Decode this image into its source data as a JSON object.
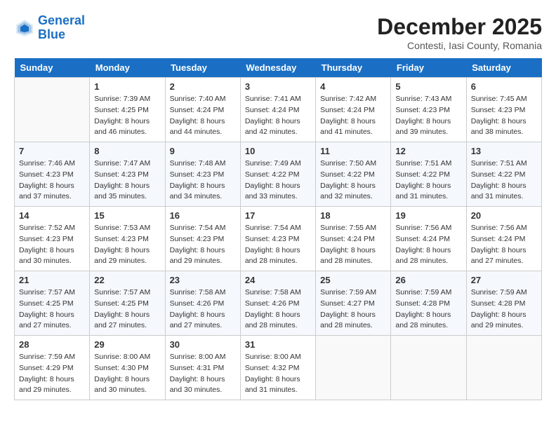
{
  "header": {
    "logo_line1": "General",
    "logo_line2": "Blue",
    "month": "December 2025",
    "location": "Contesti, Iasi County, Romania"
  },
  "weekdays": [
    "Sunday",
    "Monday",
    "Tuesday",
    "Wednesday",
    "Thursday",
    "Friday",
    "Saturday"
  ],
  "weeks": [
    [
      {
        "day": "",
        "info": ""
      },
      {
        "day": "1",
        "info": "Sunrise: 7:39 AM\nSunset: 4:25 PM\nDaylight: 8 hours\nand 46 minutes."
      },
      {
        "day": "2",
        "info": "Sunrise: 7:40 AM\nSunset: 4:24 PM\nDaylight: 8 hours\nand 44 minutes."
      },
      {
        "day": "3",
        "info": "Sunrise: 7:41 AM\nSunset: 4:24 PM\nDaylight: 8 hours\nand 42 minutes."
      },
      {
        "day": "4",
        "info": "Sunrise: 7:42 AM\nSunset: 4:24 PM\nDaylight: 8 hours\nand 41 minutes."
      },
      {
        "day": "5",
        "info": "Sunrise: 7:43 AM\nSunset: 4:23 PM\nDaylight: 8 hours\nand 39 minutes."
      },
      {
        "day": "6",
        "info": "Sunrise: 7:45 AM\nSunset: 4:23 PM\nDaylight: 8 hours\nand 38 minutes."
      }
    ],
    [
      {
        "day": "7",
        "info": "Sunrise: 7:46 AM\nSunset: 4:23 PM\nDaylight: 8 hours\nand 37 minutes."
      },
      {
        "day": "8",
        "info": "Sunrise: 7:47 AM\nSunset: 4:23 PM\nDaylight: 8 hours\nand 35 minutes."
      },
      {
        "day": "9",
        "info": "Sunrise: 7:48 AM\nSunset: 4:23 PM\nDaylight: 8 hours\nand 34 minutes."
      },
      {
        "day": "10",
        "info": "Sunrise: 7:49 AM\nSunset: 4:22 PM\nDaylight: 8 hours\nand 33 minutes."
      },
      {
        "day": "11",
        "info": "Sunrise: 7:50 AM\nSunset: 4:22 PM\nDaylight: 8 hours\nand 32 minutes."
      },
      {
        "day": "12",
        "info": "Sunrise: 7:51 AM\nSunset: 4:22 PM\nDaylight: 8 hours\nand 31 minutes."
      },
      {
        "day": "13",
        "info": "Sunrise: 7:51 AM\nSunset: 4:22 PM\nDaylight: 8 hours\nand 31 minutes."
      }
    ],
    [
      {
        "day": "14",
        "info": "Sunrise: 7:52 AM\nSunset: 4:23 PM\nDaylight: 8 hours\nand 30 minutes."
      },
      {
        "day": "15",
        "info": "Sunrise: 7:53 AM\nSunset: 4:23 PM\nDaylight: 8 hours\nand 29 minutes."
      },
      {
        "day": "16",
        "info": "Sunrise: 7:54 AM\nSunset: 4:23 PM\nDaylight: 8 hours\nand 29 minutes."
      },
      {
        "day": "17",
        "info": "Sunrise: 7:54 AM\nSunset: 4:23 PM\nDaylight: 8 hours\nand 28 minutes."
      },
      {
        "day": "18",
        "info": "Sunrise: 7:55 AM\nSunset: 4:24 PM\nDaylight: 8 hours\nand 28 minutes."
      },
      {
        "day": "19",
        "info": "Sunrise: 7:56 AM\nSunset: 4:24 PM\nDaylight: 8 hours\nand 28 minutes."
      },
      {
        "day": "20",
        "info": "Sunrise: 7:56 AM\nSunset: 4:24 PM\nDaylight: 8 hours\nand 27 minutes."
      }
    ],
    [
      {
        "day": "21",
        "info": "Sunrise: 7:57 AM\nSunset: 4:25 PM\nDaylight: 8 hours\nand 27 minutes."
      },
      {
        "day": "22",
        "info": "Sunrise: 7:57 AM\nSunset: 4:25 PM\nDaylight: 8 hours\nand 27 minutes."
      },
      {
        "day": "23",
        "info": "Sunrise: 7:58 AM\nSunset: 4:26 PM\nDaylight: 8 hours\nand 27 minutes."
      },
      {
        "day": "24",
        "info": "Sunrise: 7:58 AM\nSunset: 4:26 PM\nDaylight: 8 hours\nand 28 minutes."
      },
      {
        "day": "25",
        "info": "Sunrise: 7:59 AM\nSunset: 4:27 PM\nDaylight: 8 hours\nand 28 minutes."
      },
      {
        "day": "26",
        "info": "Sunrise: 7:59 AM\nSunset: 4:28 PM\nDaylight: 8 hours\nand 28 minutes."
      },
      {
        "day": "27",
        "info": "Sunrise: 7:59 AM\nSunset: 4:28 PM\nDaylight: 8 hours\nand 29 minutes."
      }
    ],
    [
      {
        "day": "28",
        "info": "Sunrise: 7:59 AM\nSunset: 4:29 PM\nDaylight: 8 hours\nand 29 minutes."
      },
      {
        "day": "29",
        "info": "Sunrise: 8:00 AM\nSunset: 4:30 PM\nDaylight: 8 hours\nand 30 minutes."
      },
      {
        "day": "30",
        "info": "Sunrise: 8:00 AM\nSunset: 4:31 PM\nDaylight: 8 hours\nand 30 minutes."
      },
      {
        "day": "31",
        "info": "Sunrise: 8:00 AM\nSunset: 4:32 PM\nDaylight: 8 hours\nand 31 minutes."
      },
      {
        "day": "",
        "info": ""
      },
      {
        "day": "",
        "info": ""
      },
      {
        "day": "",
        "info": ""
      }
    ]
  ]
}
